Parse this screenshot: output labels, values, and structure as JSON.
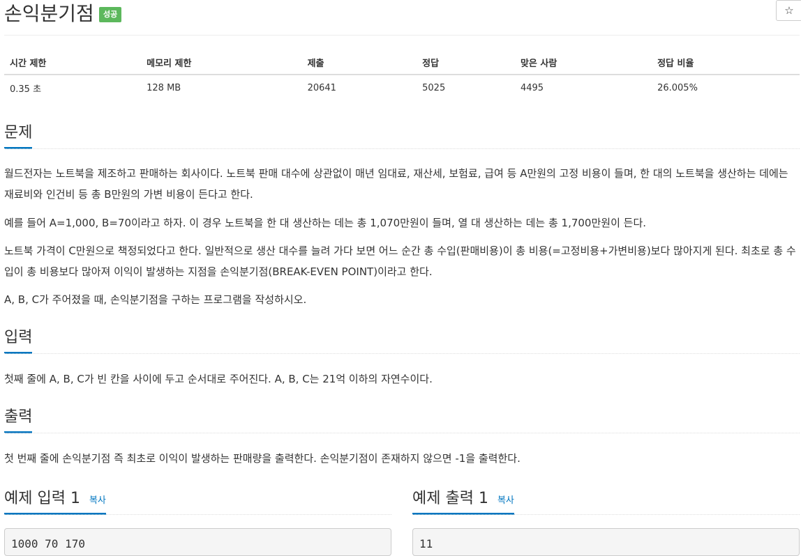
{
  "header": {
    "title": "손익분기점",
    "badge": "성공",
    "star_glyph": "☆"
  },
  "info": {
    "headers": [
      "시간 제한",
      "메모리 제한",
      "제출",
      "정답",
      "맞은 사람",
      "정답 비율"
    ],
    "values": [
      "0.35 초",
      "128 MB",
      "20641",
      "5025",
      "4495",
      "26.005%"
    ]
  },
  "problem": {
    "heading": "문제",
    "p1": "월드전자는 노트북을 제조하고 판매하는 회사이다. 노트북 판매 대수에 상관없이 매년 임대료, 재산세, 보험료, 급여 등 A만원의 고정 비용이 들며, 한 대의 노트북을 생산하는 데에는 재료비와 인건비 등 총 B만원의 가변 비용이 든다고 한다.",
    "p2": "예를 들어 A=1,000, B=70이라고 하자. 이 경우 노트북을 한 대 생산하는 데는 총 1,070만원이 들며, 열 대 생산하는 데는 총 1,700만원이 든다.",
    "p3": "노트북 가격이 C만원으로 책정되었다고 한다. 일반적으로 생산 대수를 늘려 가다 보면 어느 순간 총 수입(판매비용)이 총 비용(=고정비용+가변비용)보다 많아지게 된다. 최초로 총 수입이 총 비용보다 많아져 이익이 발생하는 지점을 손익분기점(BREAK-EVEN POINT)이라고 한다.",
    "p4": "A, B, C가 주어졌을 때, 손익분기점을 구하는 프로그램을 작성하시오."
  },
  "input": {
    "heading": "입력",
    "text": "첫째 줄에 A, B, C가 빈 칸을 사이에 두고 순서대로 주어진다. A, B, C는 21억 이하의 자연수이다."
  },
  "output": {
    "heading": "출력",
    "text": "첫 번째 줄에 손익분기점 즉 최초로 이익이 발생하는 판매량을 출력한다. 손익분기점이 존재하지 않으면 -1을 출력한다."
  },
  "examples": {
    "input_heading": "예제 입력 1",
    "output_heading": "예제 출력 1",
    "copy_label": "복사",
    "input_value": "1000 70 170",
    "output_value": "11"
  }
}
